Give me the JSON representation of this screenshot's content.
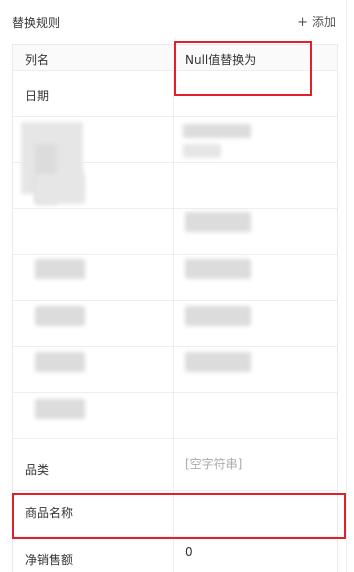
{
  "header": {
    "title": "替换规则",
    "add_label": "添加",
    "add_icon": "plus-icon"
  },
  "table": {
    "column_header_left": "列名",
    "column_header_right": "Null值替换为",
    "rows": [
      {
        "name": "日期",
        "value": ""
      },
      {
        "name": "品类",
        "value": "",
        "placeholder": "[空字符串]"
      },
      {
        "name": "商品名称",
        "value": ""
      },
      {
        "name": "净销售额",
        "value": "0"
      }
    ]
  },
  "colors": {
    "highlight": "#e0202a",
    "placeholder": "#aaaaaa",
    "border": "#eeeeee"
  }
}
